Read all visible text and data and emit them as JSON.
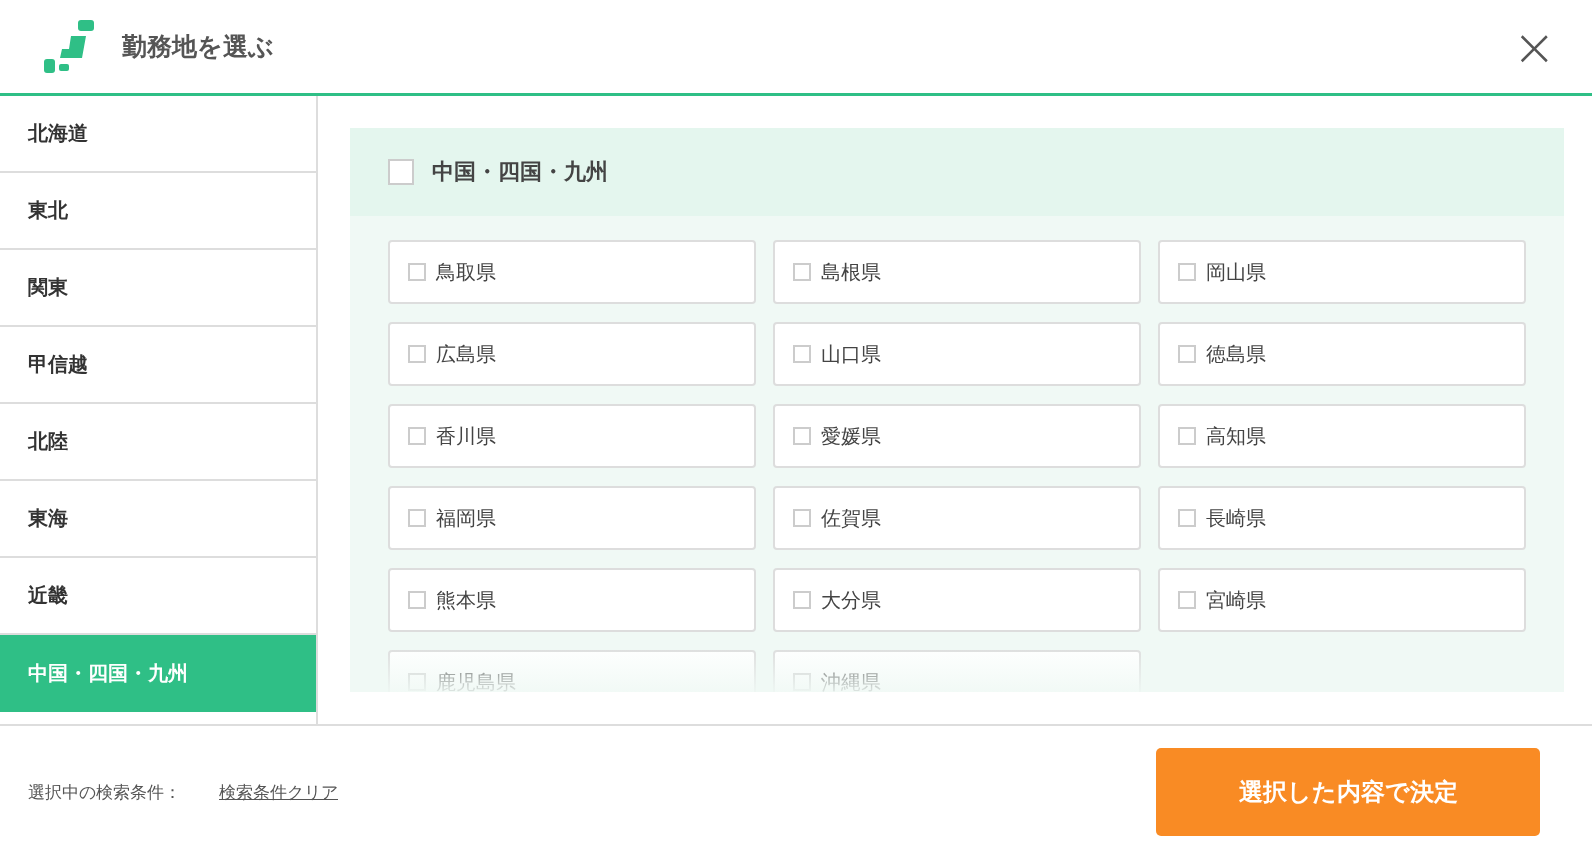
{
  "header": {
    "title": "勤務地を選ぶ",
    "close": "×"
  },
  "regions": [
    {
      "label": "北海道",
      "selected": false
    },
    {
      "label": "東北",
      "selected": false
    },
    {
      "label": "関東",
      "selected": false
    },
    {
      "label": "甲信越",
      "selected": false
    },
    {
      "label": "北陸",
      "selected": false
    },
    {
      "label": "東海",
      "selected": false
    },
    {
      "label": "近畿",
      "selected": false
    },
    {
      "label": "中国・四国・九州",
      "selected": true
    }
  ],
  "panel": {
    "title": "中国・四国・九州",
    "checked": false,
    "prefectures": [
      {
        "label": "鳥取県",
        "checked": false
      },
      {
        "label": "島根県",
        "checked": false
      },
      {
        "label": "岡山県",
        "checked": false
      },
      {
        "label": "広島県",
        "checked": false
      },
      {
        "label": "山口県",
        "checked": false
      },
      {
        "label": "徳島県",
        "checked": false
      },
      {
        "label": "香川県",
        "checked": false
      },
      {
        "label": "愛媛県",
        "checked": false
      },
      {
        "label": "高知県",
        "checked": false
      },
      {
        "label": "福岡県",
        "checked": false
      },
      {
        "label": "佐賀県",
        "checked": false
      },
      {
        "label": "長崎県",
        "checked": false
      },
      {
        "label": "熊本県",
        "checked": false
      },
      {
        "label": "大分県",
        "checked": false
      },
      {
        "label": "宮崎県",
        "checked": false
      },
      {
        "label": "鹿児島県",
        "checked": false
      },
      {
        "label": "沖縄県",
        "checked": false
      }
    ]
  },
  "footer": {
    "conditions_label": "選択中の検索条件：",
    "clear_link": "検索条件クリア",
    "submit": "選択した内容で決定"
  }
}
